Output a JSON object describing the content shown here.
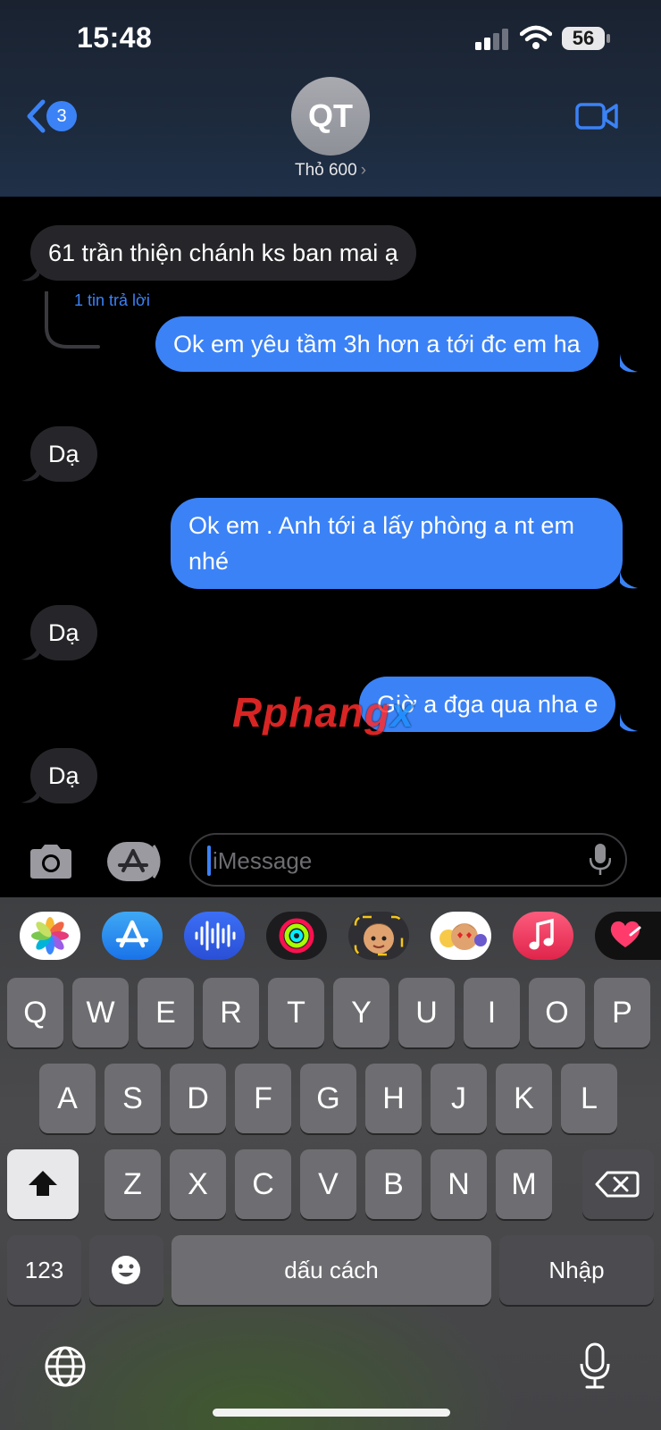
{
  "status_bar": {
    "time": "15:48",
    "battery": "56"
  },
  "header": {
    "back_count": "3",
    "avatar_initials": "QT",
    "contact_name": "Thỏ 600",
    "chevron": "›"
  },
  "messages": [
    {
      "from": "in",
      "text": "61 trần thiện chánh ks ban mai ạ"
    },
    {
      "from": "out",
      "text": "Ok em yêu tầm 3h hơn a tới đc em ha"
    },
    {
      "from": "in",
      "text": "Dạ"
    },
    {
      "from": "out",
      "text": "Ok em . Anh tới a lấy phòng a nt em nhé"
    },
    {
      "from": "in",
      "text": "Dạ"
    },
    {
      "from": "out",
      "text": "Giờ a đga qua nha e"
    },
    {
      "from": "in",
      "text": "Dạ"
    }
  ],
  "reply_count_label": "1 tin trả lời",
  "watermark": {
    "part1": "Rphang",
    "part2": "x"
  },
  "input": {
    "placeholder": "iMessage"
  },
  "app_strip": [
    "photos-icon",
    "app-store-icon",
    "audio-message-icon",
    "fitness-icon",
    "memoji-icon",
    "memoji-stickers-icon",
    "music-icon",
    "digital-touch-icon"
  ],
  "keyboard": {
    "row1": [
      "Q",
      "W",
      "E",
      "R",
      "T",
      "Y",
      "U",
      "I",
      "O",
      "P"
    ],
    "row2": [
      "A",
      "S",
      "D",
      "F",
      "G",
      "H",
      "J",
      "K",
      "L"
    ],
    "row3": [
      "Z",
      "X",
      "C",
      "V",
      "B",
      "N",
      "M"
    ],
    "numbers_key": "123",
    "space_key": "dấu cách",
    "return_key": "Nhập"
  },
  "colors": {
    "accent": "#3b82f6",
    "incoming": "#26262a",
    "background": "#000000"
  }
}
